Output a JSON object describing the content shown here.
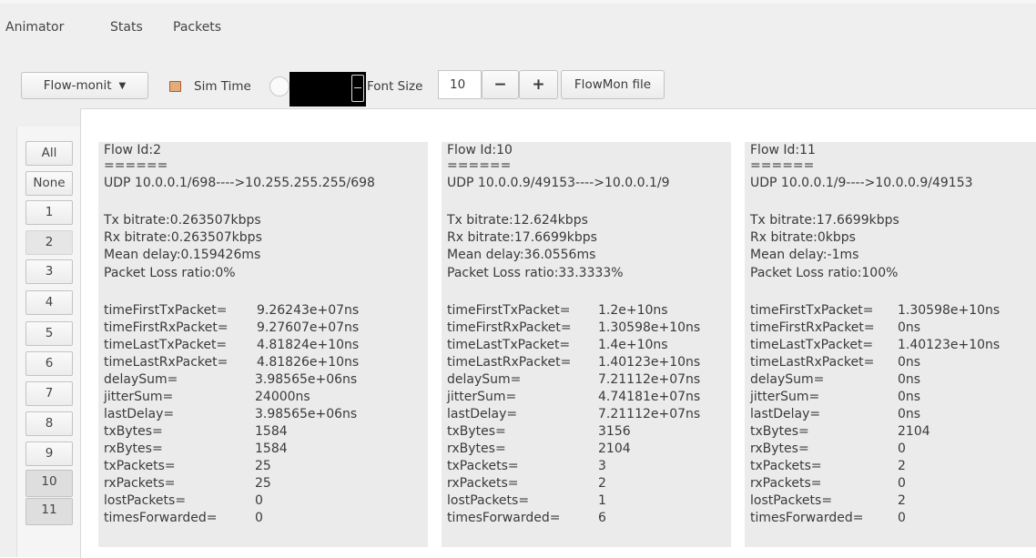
{
  "tabs": [
    "Animator",
    "Stats",
    "Packets"
  ],
  "toolbar": {
    "dropdown_label": "Flow-monit",
    "sim_time_label": "Sim Time",
    "font_size_label": "Font Size",
    "font_size_value": "10",
    "decrement_label": "−",
    "increment_label": "+",
    "flowmon_file_label": "FlowMon file"
  },
  "flow_selector": [
    "All",
    "None",
    "1",
    "2",
    "3",
    "4",
    "5",
    "6",
    "7",
    "8",
    "9",
    "10",
    "11"
  ],
  "flows": [
    {
      "header": "Flow Id:2",
      "separator": "======",
      "route": "UDP 10.0.0.1/698---->10.255.255.255/698",
      "tx_bitrate": "Tx bitrate:0.263507kbps",
      "rx_bitrate": "Rx bitrate:0.263507kbps",
      "mean_delay": "Mean delay:0.159426ms",
      "loss_ratio": "Packet Loss ratio:0%",
      "stats": [
        {
          "k": "timeFirstTxPacket=",
          "v": "9.26243e+07ns"
        },
        {
          "k": "timeFirstRxPacket=",
          "v": "9.27607e+07ns"
        },
        {
          "k": "timeLastTxPacket=",
          "v": "4.81824e+10ns"
        },
        {
          "k": "timeLastRxPacket=",
          "v": "4.81826e+10ns"
        },
        {
          "k": "delaySum=",
          "v": "3.98565e+06ns"
        },
        {
          "k": "jitterSum=",
          "v": "24000ns"
        },
        {
          "k": "lastDelay=",
          "v": "3.98565e+06ns"
        },
        {
          "k": "txBytes=",
          "v": "1584"
        },
        {
          "k": "rxBytes=",
          "v": "1584"
        },
        {
          "k": "txPackets=",
          "v": "25"
        },
        {
          "k": "rxPackets=",
          "v": "25"
        },
        {
          "k": "lostPackets=",
          "v": "0"
        },
        {
          "k": "timesForwarded=",
          "v": "0"
        }
      ]
    },
    {
      "header": "Flow Id:10",
      "separator": "======",
      "route": "UDP 10.0.0.9/49153---->10.0.0.1/9",
      "tx_bitrate": "Tx bitrate:12.624kbps",
      "rx_bitrate": "Rx bitrate:17.6699kbps",
      "mean_delay": "Mean delay:36.0556ms",
      "loss_ratio": "Packet Loss ratio:33.3333%",
      "stats": [
        {
          "k": "timeFirstTxPacket=",
          "v": "1.2e+10ns"
        },
        {
          "k": "timeFirstRxPacket=",
          "v": "1.30598e+10ns"
        },
        {
          "k": "timeLastTxPacket=",
          "v": "1.4e+10ns"
        },
        {
          "k": "timeLastRxPacket=",
          "v": "1.40123e+10ns"
        },
        {
          "k": "delaySum=",
          "v": "7.21112e+07ns"
        },
        {
          "k": "jitterSum=",
          "v": "4.74181e+07ns"
        },
        {
          "k": "lastDelay=",
          "v": "7.21112e+07ns"
        },
        {
          "k": "txBytes=",
          "v": "3156"
        },
        {
          "k": "rxBytes=",
          "v": "2104"
        },
        {
          "k": "txPackets=",
          "v": "3"
        },
        {
          "k": "rxPackets=",
          "v": "2"
        },
        {
          "k": "lostPackets=",
          "v": "1"
        },
        {
          "k": "timesForwarded=",
          "v": "6"
        }
      ]
    },
    {
      "header": "Flow Id:11",
      "separator": "======",
      "route": "UDP 10.0.0.1/9---->10.0.0.9/49153",
      "tx_bitrate": "Tx bitrate:17.6699kbps",
      "rx_bitrate": "Rx bitrate:0kbps",
      "mean_delay": "Mean delay:-1ms",
      "loss_ratio": "Packet Loss ratio:100%",
      "stats": [
        {
          "k": "timeFirstTxPacket=",
          "v": "1.30598e+10ns"
        },
        {
          "k": "timeFirstRxPacket=",
          "v": "0ns"
        },
        {
          "k": "timeLastTxPacket=",
          "v": "1.40123e+10ns"
        },
        {
          "k": "timeLastRxPacket=",
          "v": "0ns"
        },
        {
          "k": "delaySum=",
          "v": "0ns"
        },
        {
          "k": "jitterSum=",
          "v": "0ns"
        },
        {
          "k": "lastDelay=",
          "v": "0ns"
        },
        {
          "k": "txBytes=",
          "v": "2104"
        },
        {
          "k": "rxBytes=",
          "v": "0"
        },
        {
          "k": "txPackets=",
          "v": "2"
        },
        {
          "k": "rxPackets=",
          "v": "0"
        },
        {
          "k": "lostPackets=",
          "v": "2"
        },
        {
          "k": "timesForwarded=",
          "v": "0"
        }
      ]
    }
  ]
}
